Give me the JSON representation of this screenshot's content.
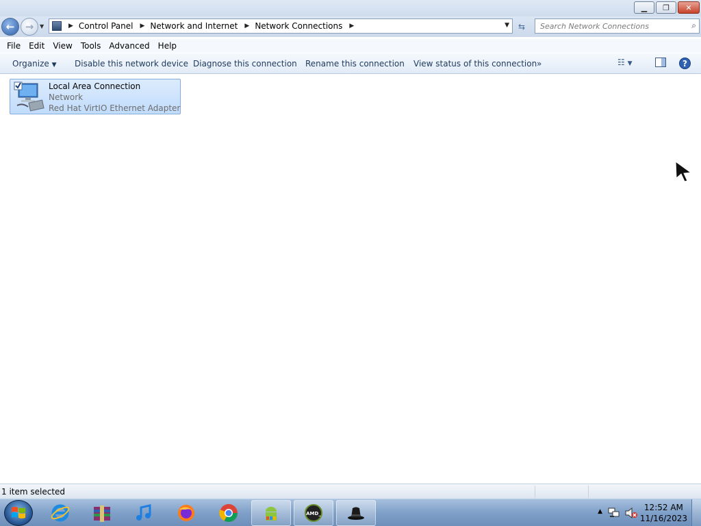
{
  "window": {
    "minimize_icon": "minimize-icon",
    "maximize_icon": "restore-icon",
    "close_icon": "close-icon"
  },
  "address": {
    "crumbs": [
      "Control Panel",
      "Network and Internet",
      "Network Connections"
    ],
    "search_placeholder": "Search Network Connections"
  },
  "menu": {
    "items": [
      "File",
      "Edit",
      "View",
      "Tools",
      "Advanced",
      "Help"
    ]
  },
  "commands": {
    "organize": "Organize",
    "disable": "Disable this network device",
    "diagnose": "Diagnose this connection",
    "rename": "Rename this connection",
    "view_status": "View status of this connection",
    "more": "»"
  },
  "connection": {
    "name": "Local Area Connection",
    "network": "Network",
    "adapter": "Red Hat VirtIO Ethernet Adapter",
    "checked": true
  },
  "status": {
    "text": "1 item selected"
  },
  "taskbar": {
    "apps": [
      "Internet Explorer",
      "WinRAR",
      "iTunes",
      "Firefox",
      "Chrome",
      "Android",
      "AMD",
      "Black Hat"
    ],
    "time": "12:52 AM",
    "date": "11/16/2023"
  }
}
